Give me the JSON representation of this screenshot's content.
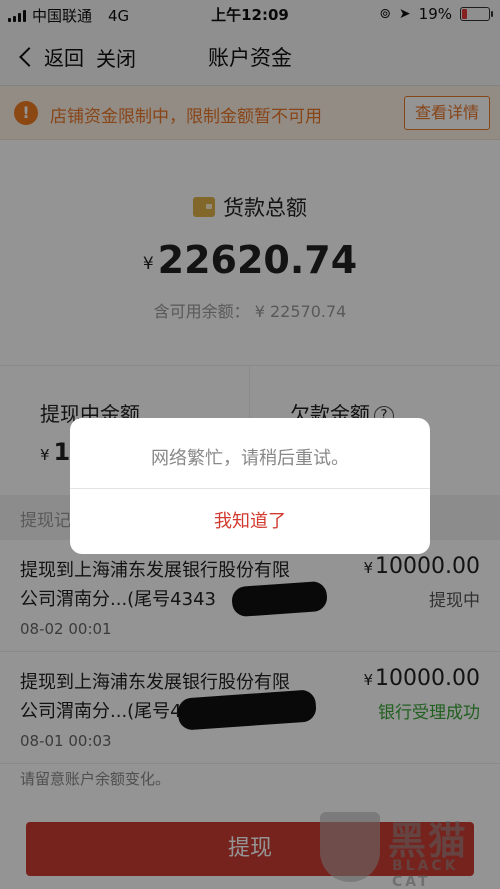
{
  "status_bar": {
    "carrier": "中国联通",
    "network": "4G",
    "time": "上午12:09",
    "battery_percent": "19%",
    "battery_level": 0.19,
    "battery_color": "#e53935"
  },
  "nav": {
    "back_label": "返回",
    "close_label": "关闭",
    "title": "账户资金"
  },
  "banner": {
    "icon": "warning-icon",
    "icon_glyph": "!",
    "message": "店铺资金限制中，限制金额暂不可用",
    "detail_button": "查看详情",
    "accent_color": "#e8772a"
  },
  "total": {
    "icon": "wallet-icon",
    "title": "货款总额",
    "currency": "¥",
    "amount": "22620.74",
    "available": "含可用余额： ¥ 22570.74"
  },
  "columns": {
    "withdrawing": {
      "label": "提现中金额",
      "currency": "¥",
      "value": "10"
    },
    "debt": {
      "label": "欠款金额",
      "help_glyph": "?"
    }
  },
  "records_header": "提现记录",
  "records": [
    {
      "description": "提现到上海浦东发展银行股份有限公司渭南分...(尾号4343",
      "date": "08-02 00:01",
      "currency": "¥",
      "amount": "10000.00",
      "status": "提现中"
    },
    {
      "description": "提现到上海浦东发展银行股份有限公司渭南分...(尾号4343",
      "date": "08-01 00:03",
      "currency": "¥",
      "amount": "10000.00",
      "status": "银行受理成功",
      "status_color": "#3aa53a"
    }
  ],
  "note": "请留意账户余额变化。",
  "withdraw_button": "提现",
  "watermark": {
    "cn": "黑猫",
    "en": "BLACK CAT"
  },
  "dialog": {
    "message": "网络繁忙，请稍后重试。",
    "confirm": "我知道了",
    "confirm_color": "#d23a2f"
  }
}
